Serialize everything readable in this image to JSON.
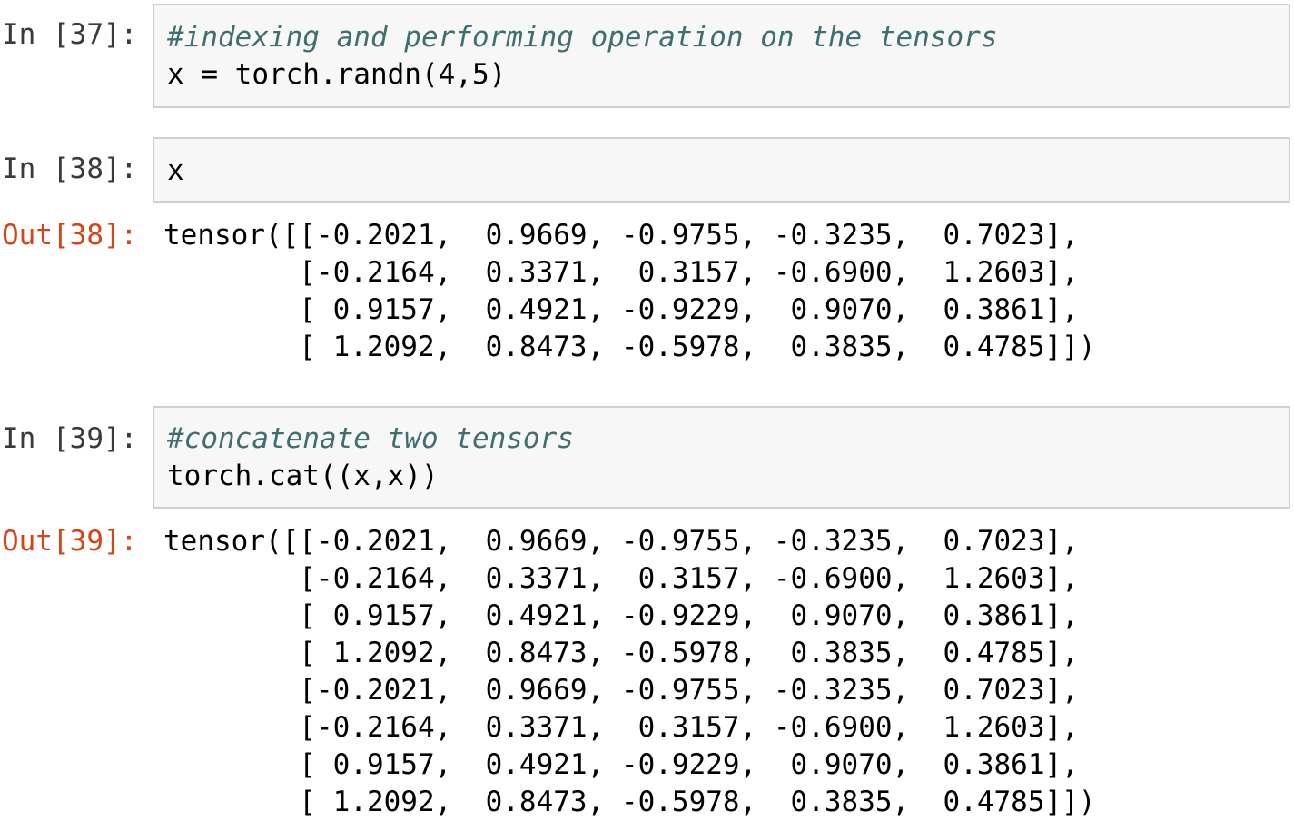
{
  "cells": [
    {
      "in_prompt": "In [37]:",
      "input_lines": [
        {
          "text": "#indexing and performing operation on the tensors",
          "comment": true
        },
        {
          "text": "x = torch.randn(4,5)",
          "comment": false
        }
      ]
    },
    {
      "in_prompt": "In [38]:",
      "input_lines": [
        {
          "text": "x",
          "comment": false
        }
      ],
      "out_prompt": "Out[38]:",
      "output_lines": [
        "tensor([[-0.2021,  0.9669, -0.9755, -0.3235,  0.7023],",
        "        [-0.2164,  0.3371,  0.3157, -0.6900,  1.2603],",
        "        [ 0.9157,  0.4921, -0.9229,  0.9070,  0.3861],",
        "        [ 1.2092,  0.8473, -0.5978,  0.3835,  0.4785]])"
      ]
    },
    {
      "in_prompt": "In [39]:",
      "input_lines": [
        {
          "text": "#concatenate two tensors",
          "comment": true
        },
        {
          "text": "torch.cat((x,x))",
          "comment": false
        }
      ],
      "out_prompt": "Out[39]:",
      "output_lines": [
        "tensor([[-0.2021,  0.9669, -0.9755, -0.3235,  0.7023],",
        "        [-0.2164,  0.3371,  0.3157, -0.6900,  1.2603],",
        "        [ 0.9157,  0.4921, -0.9229,  0.9070,  0.3861],",
        "        [ 1.2092,  0.8473, -0.5978,  0.3835,  0.4785],",
        "        [-0.2021,  0.9669, -0.9755, -0.3235,  0.7023],",
        "        [-0.2164,  0.3371,  0.3157, -0.6900,  1.2603],",
        "        [ 0.9157,  0.4921, -0.9229,  0.9070,  0.3861],",
        "        [ 1.2092,  0.8473, -0.5978,  0.3835,  0.4785]])"
      ]
    }
  ]
}
